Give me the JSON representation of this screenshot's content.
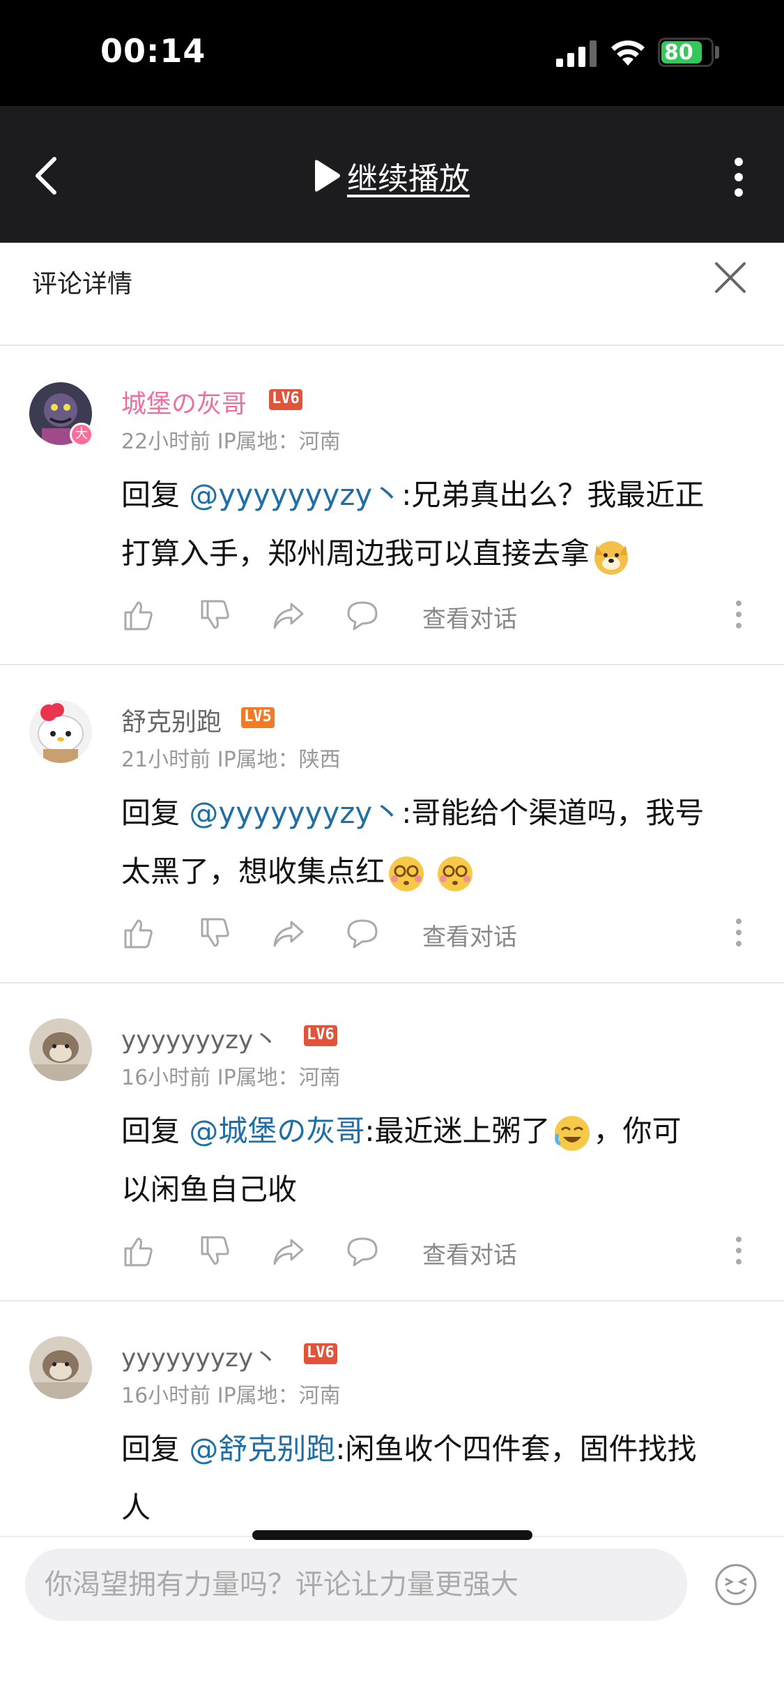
{
  "status": {
    "time": "00:14",
    "battery": "80",
    "battery_fraction": 0.8
  },
  "player": {
    "continue_label": "继续播放"
  },
  "detail": {
    "title": "评论详情"
  },
  "comments": [
    {
      "username": "城堡の灰哥",
      "level": "LV6",
      "level_color": "#e0553a",
      "time": "22小时前",
      "ip": "IP属地：河南",
      "reply_prefix": "回复",
      "mention": "@yyyyyyyzy丶",
      "text_line1": ":兄弟真出么？我最近正",
      "text_line2": "打算入手，郑州周边我可以直接去拿",
      "vip": true,
      "badge": "大"
    },
    {
      "username": "舒克别跑",
      "level": "LV5",
      "level_color": "#f07b27",
      "time": "21小时前",
      "ip": "IP属地：陕西",
      "reply_prefix": "回复",
      "mention": "@yyyyyyyzy丶",
      "text_line1": ":哥能给个渠道吗，我号",
      "text_line2": "太黑了，想收集点红"
    },
    {
      "username": "yyyyyyyzy丶",
      "level": "LV6",
      "level_color": "#e0553a",
      "time": "16小时前",
      "ip": "IP属地：河南",
      "reply_prefix": "回复",
      "mention": "@城堡の灰哥",
      "text_line1": ":最近迷上粥了",
      "text_line1b": "，你可",
      "text_line2": "以闲鱼自己收"
    },
    {
      "username": "yyyyyyyzy丶",
      "level": "LV6",
      "level_color": "#e0553a",
      "time": "16小时前",
      "ip": "IP属地：河南",
      "reply_prefix": "回复",
      "mention": "@舒克别跑",
      "text_line1": ":闲鱼收个四件套，固件找找",
      "text_line2": "人"
    }
  ],
  "actions": {
    "view_conversation": "查看对话"
  },
  "input": {
    "placeholder": "你渴望拥有力量吗？评论让力量更强大"
  },
  "icons": [
    "back-icon",
    "play-icon",
    "more-icon",
    "close-icon",
    "like-icon",
    "dislike-icon",
    "share-icon",
    "reply-icon",
    "emoji-icon"
  ]
}
